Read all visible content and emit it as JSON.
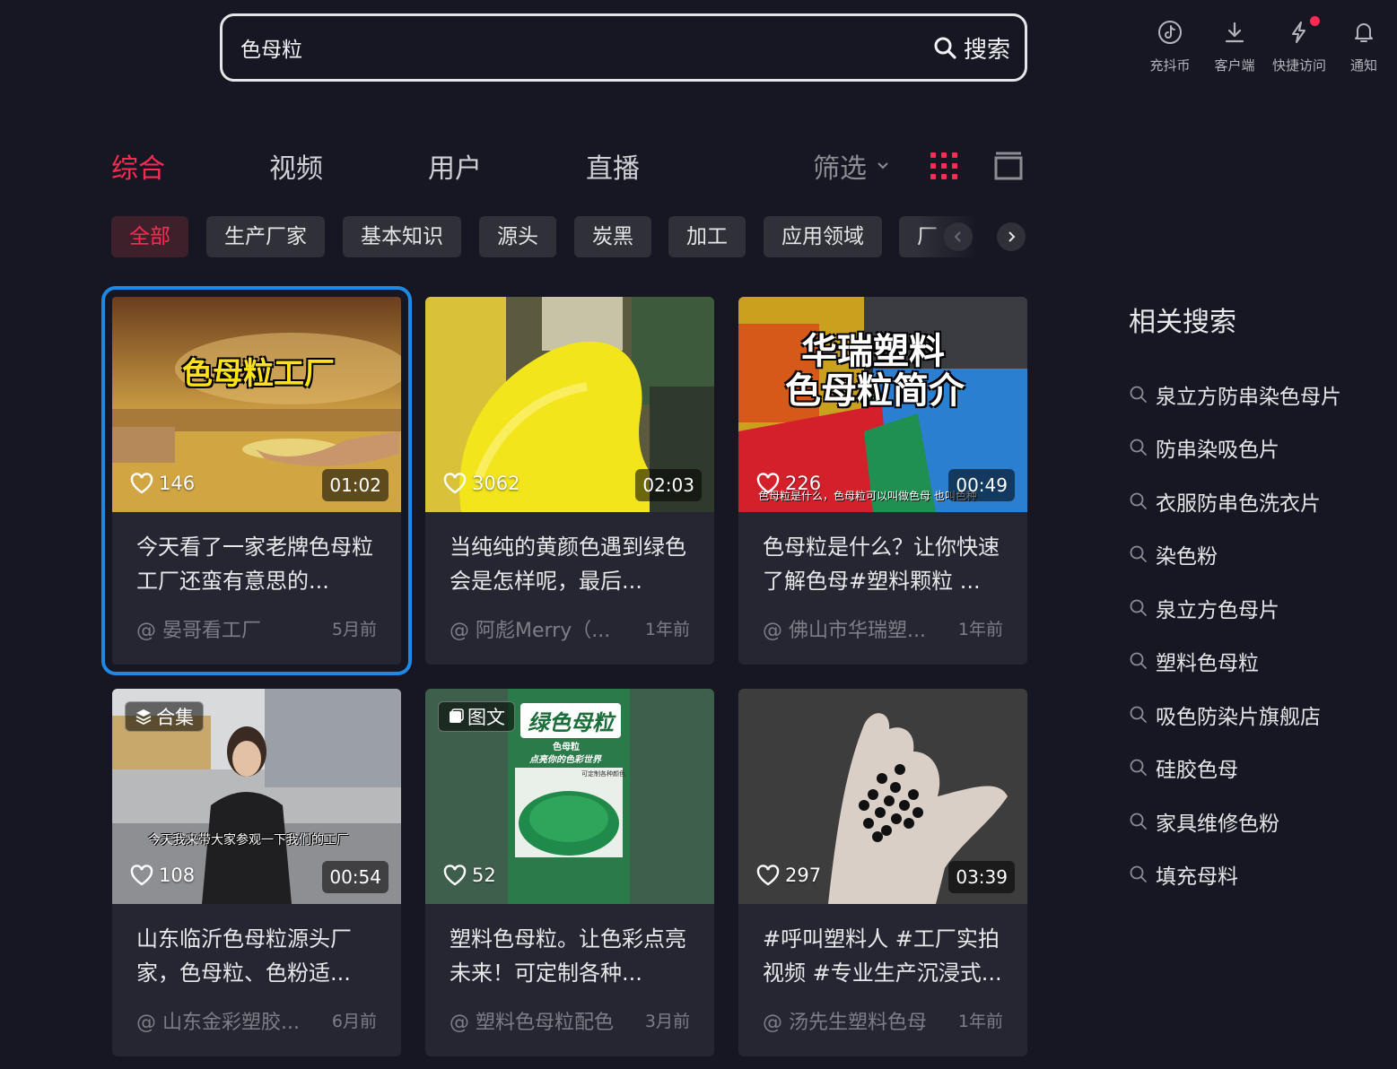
{
  "search": {
    "value": "色母粒",
    "button_label": "搜索"
  },
  "top_tools": [
    {
      "label": "充抖币",
      "icon": "douyin-coin-icon"
    },
    {
      "label": "客户端",
      "icon": "download-icon"
    },
    {
      "label": "快捷访问",
      "icon": "lightning-icon"
    },
    {
      "label": "通知",
      "icon": "bell-icon"
    }
  ],
  "tabs": [
    {
      "label": "综合",
      "active": true
    },
    {
      "label": "视频"
    },
    {
      "label": "用户"
    },
    {
      "label": "直播"
    }
  ],
  "filter_label": "筛选",
  "chips": [
    "全部",
    "生产厂家",
    "基本知识",
    "源头",
    "炭黑",
    "加工",
    "应用领域",
    "厂"
  ],
  "cards": [
    {
      "likes": "146",
      "duration": "01:02",
      "title": "今天看了一家老牌色母粒工厂还蛮有意思的...",
      "author": "@ 晏哥看工厂",
      "time": "5月前",
      "thumb_text": "色母粒工厂"
    },
    {
      "likes": "3062",
      "duration": "02:03",
      "title": "当纯纯的黄颜色遇到绿色会是怎样呢，最后...",
      "author": "@ 阿彪Merry（...",
      "time": "1年前"
    },
    {
      "likes": "226",
      "duration": "00:49",
      "title": "色母粒是什么？让你快速了解色母#塑料颗粒 ...",
      "author": "@ 佛山市华瑞塑...",
      "time": "1年前",
      "thumb_text_1": "华瑞塑料",
      "thumb_text_2": "色母粒简介",
      "thumb_caption": "色母粒是什么，色母粒可以叫做色母 也叫色种"
    },
    {
      "likes": "108",
      "duration": "00:54",
      "badge": "合集",
      "title": "山东临沂色母粒源头厂家，色母粒、色粉适...",
      "author": "@ 山东金彩塑胶...",
      "time": "6月前",
      "thumb_caption": "今天我来带大家参观一下我们的工厂"
    },
    {
      "likes": "52",
      "badge": "图文",
      "title": "塑料色母粒。让色彩点亮未来！可定制各种...",
      "author": "@ 塑料色母粒配色",
      "time": "3月前",
      "thumb_text": "绿色母粒",
      "thumb_sub_1": "色母粒",
      "thumb_sub_2": "点亮你的色彩世界",
      "thumb_sub_3": "可定制各种颜色"
    },
    {
      "likes": "297",
      "duration": "03:39",
      "title": "#呼叫塑料人 #工厂实拍视频 #专业生产沉浸式...",
      "author": "@ 汤先生塑料色母",
      "time": "1年前"
    }
  ],
  "related": {
    "title": "相关搜索",
    "items": [
      "泉立方防串染色母片",
      "防串染吸色片",
      "衣服防串色洗衣片",
      "染色粉",
      "泉立方色母片",
      "塑料色母粒",
      "吸色防染片旗舰店",
      "硅胶色母",
      "家具维修色粉",
      "填充母料"
    ]
  },
  "colors": {
    "accent": "#fe2c55",
    "background": "#161722",
    "card": "#252631",
    "selection": "#1e88e5"
  }
}
